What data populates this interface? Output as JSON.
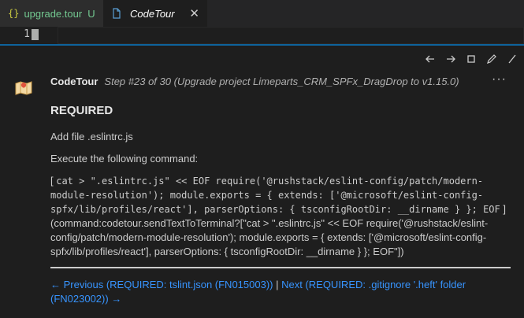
{
  "tabs": [
    {
      "label": "upgrade.tour",
      "icon": "{}",
      "badge": "U"
    },
    {
      "label": "CodeTour"
    }
  ],
  "editor": {
    "line_number": "1"
  },
  "comment": {
    "author": "CodeTour",
    "step": "Step #23 of 30 (Upgrade project Limeparts_CRM_SPFx_DragDrop to v1.15.0)",
    "more": "···",
    "heading": "REQUIRED",
    "para1": "Add file .eslintrc.js",
    "para2": "Execute the following command:",
    "cmd_pre": "[ ",
    "cmd_code": "cat > \".eslintrc.js\" << EOF require('@rushstack/eslint-config/patch/modern-module-resolution'); module.exports = { extends: ['@microsoft/eslint-config-spfx/lib/profiles/react'], parserOptions: { tsconfigRootDir: __dirname } }; EOF",
    "cmd_post": " ](command:codetour.sendTextToTerminal?[\"cat > \".eslintrc.js\" << EOF require('@rushstack/eslint-config/patch/modern-module-resolution'); module.exports = { extends: ['@microsoft/eslint-config-spfx/lib/profiles/react'], parserOptions: { tsconfigRootDir: __dirname } }; EOF\"])",
    "nav_prev_arrow": "← ",
    "nav_prev": "Previous (REQUIRED: tslint.json (FN015003))",
    "nav_sep": " | ",
    "nav_next": "Next (REQUIRED: .gitignore '.heft' folder (FN023002))",
    "nav_next_arrow": "→"
  },
  "colors": {
    "accent": "#0e639c",
    "link": "#3794ff",
    "untracked": "#73c991"
  }
}
